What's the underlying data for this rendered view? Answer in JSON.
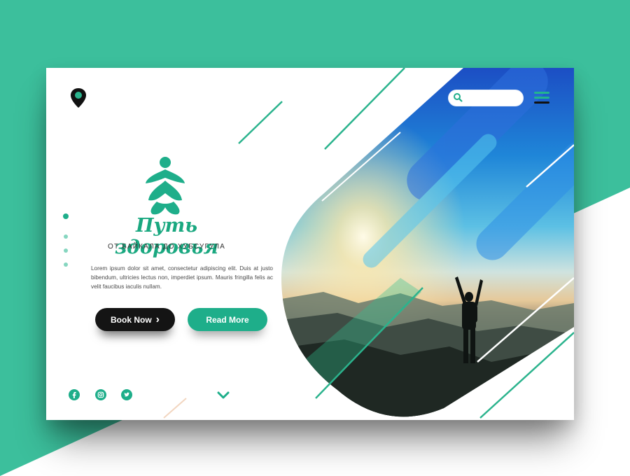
{
  "brand": {
    "title": "Путь здоровья",
    "subtitle": "ОТ БАЙКАЛА ДО ХУБСУГУЛА"
  },
  "search": {
    "value": "",
    "placeholder": ""
  },
  "intro": {
    "text": "Lorem ipsum dolor sit amet, consectetur adipiscing elit. Duis at justo bibendum, ultricies lectus non, imperdiet ipsum. Mauris fringilla felis ac velit faucibus iaculis nullam."
  },
  "buttons": {
    "book_label": "Book Now",
    "book_arrow": "›",
    "read_label": "Read More"
  },
  "slider": {
    "total": 4,
    "active": 1
  },
  "social": [
    "facebook-icon",
    "instagram-icon",
    "twitter-icon"
  ],
  "colors": {
    "teal": "#3cbf9c",
    "accent": "#1eae8a",
    "dark": "#141414",
    "dot_inactive": "#86d6c0"
  }
}
